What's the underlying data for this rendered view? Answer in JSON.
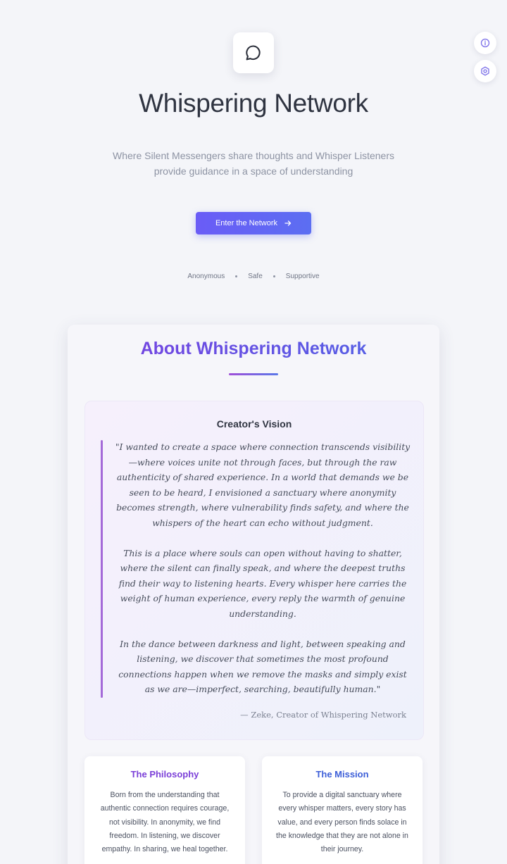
{
  "hero": {
    "title": "Whispering Network",
    "subtitle": "Where Silent Messengers share thoughts and Whisper Listeners provide guidance in a space of understanding",
    "cta_label": "Enter the Network",
    "cta_icon": "arrow-right-icon",
    "logo_icon": "chat-bubble-icon",
    "tags": [
      "Anonymous",
      "Safe",
      "Supportive"
    ]
  },
  "corner_buttons": {
    "info_icon": "info-icon",
    "settings_icon": "gear-icon"
  },
  "about": {
    "title": "About Whispering Network",
    "vision": {
      "heading": "Creator's Vision",
      "paragraphs": [
        "\"I wanted to create a space where connection transcends visibility—where voices unite not through faces, but through the raw authenticity of shared experience. In a world that demands we be seen to be heard, I envisioned a sanctuary where anonymity becomes strength, where vulnerability finds safety, and where the whispers of the heart can echo without judgment.",
        "This is a place where souls can open without having to shatter, where the silent can finally speak, and where the deepest truths find their way to listening hearts. Every whisper here carries the weight of human experience, every reply the warmth of genuine understanding.",
        "In the dance between darkness and light, between speaking and listening, we discover that sometimes the most profound connections happen when we remove the masks and simply exist as we are—imperfect, searching, beautifully human.\""
      ],
      "credit": "— Zeke, Creator of Whispering Network"
    },
    "philosophy": {
      "title": "The Philosophy",
      "text": "Born from the understanding that authentic connection requires courage, not visibility. In anonymity, we find freedom. In listening, we discover empathy. In sharing, we heal together."
    },
    "mission": {
      "title": "The Mission",
      "text": "To provide a digital sanctuary where every whisper matters, every story has value, and every person finds solace in the knowledge that they are not alone in their journey."
    }
  },
  "colors": {
    "accent": "#6a5cf6",
    "about_gradient_start": "#7a3fe0",
    "about_gradient_end": "#4f66e6",
    "vision_bar": "#a46ad8",
    "background": "#f4f5f9"
  }
}
